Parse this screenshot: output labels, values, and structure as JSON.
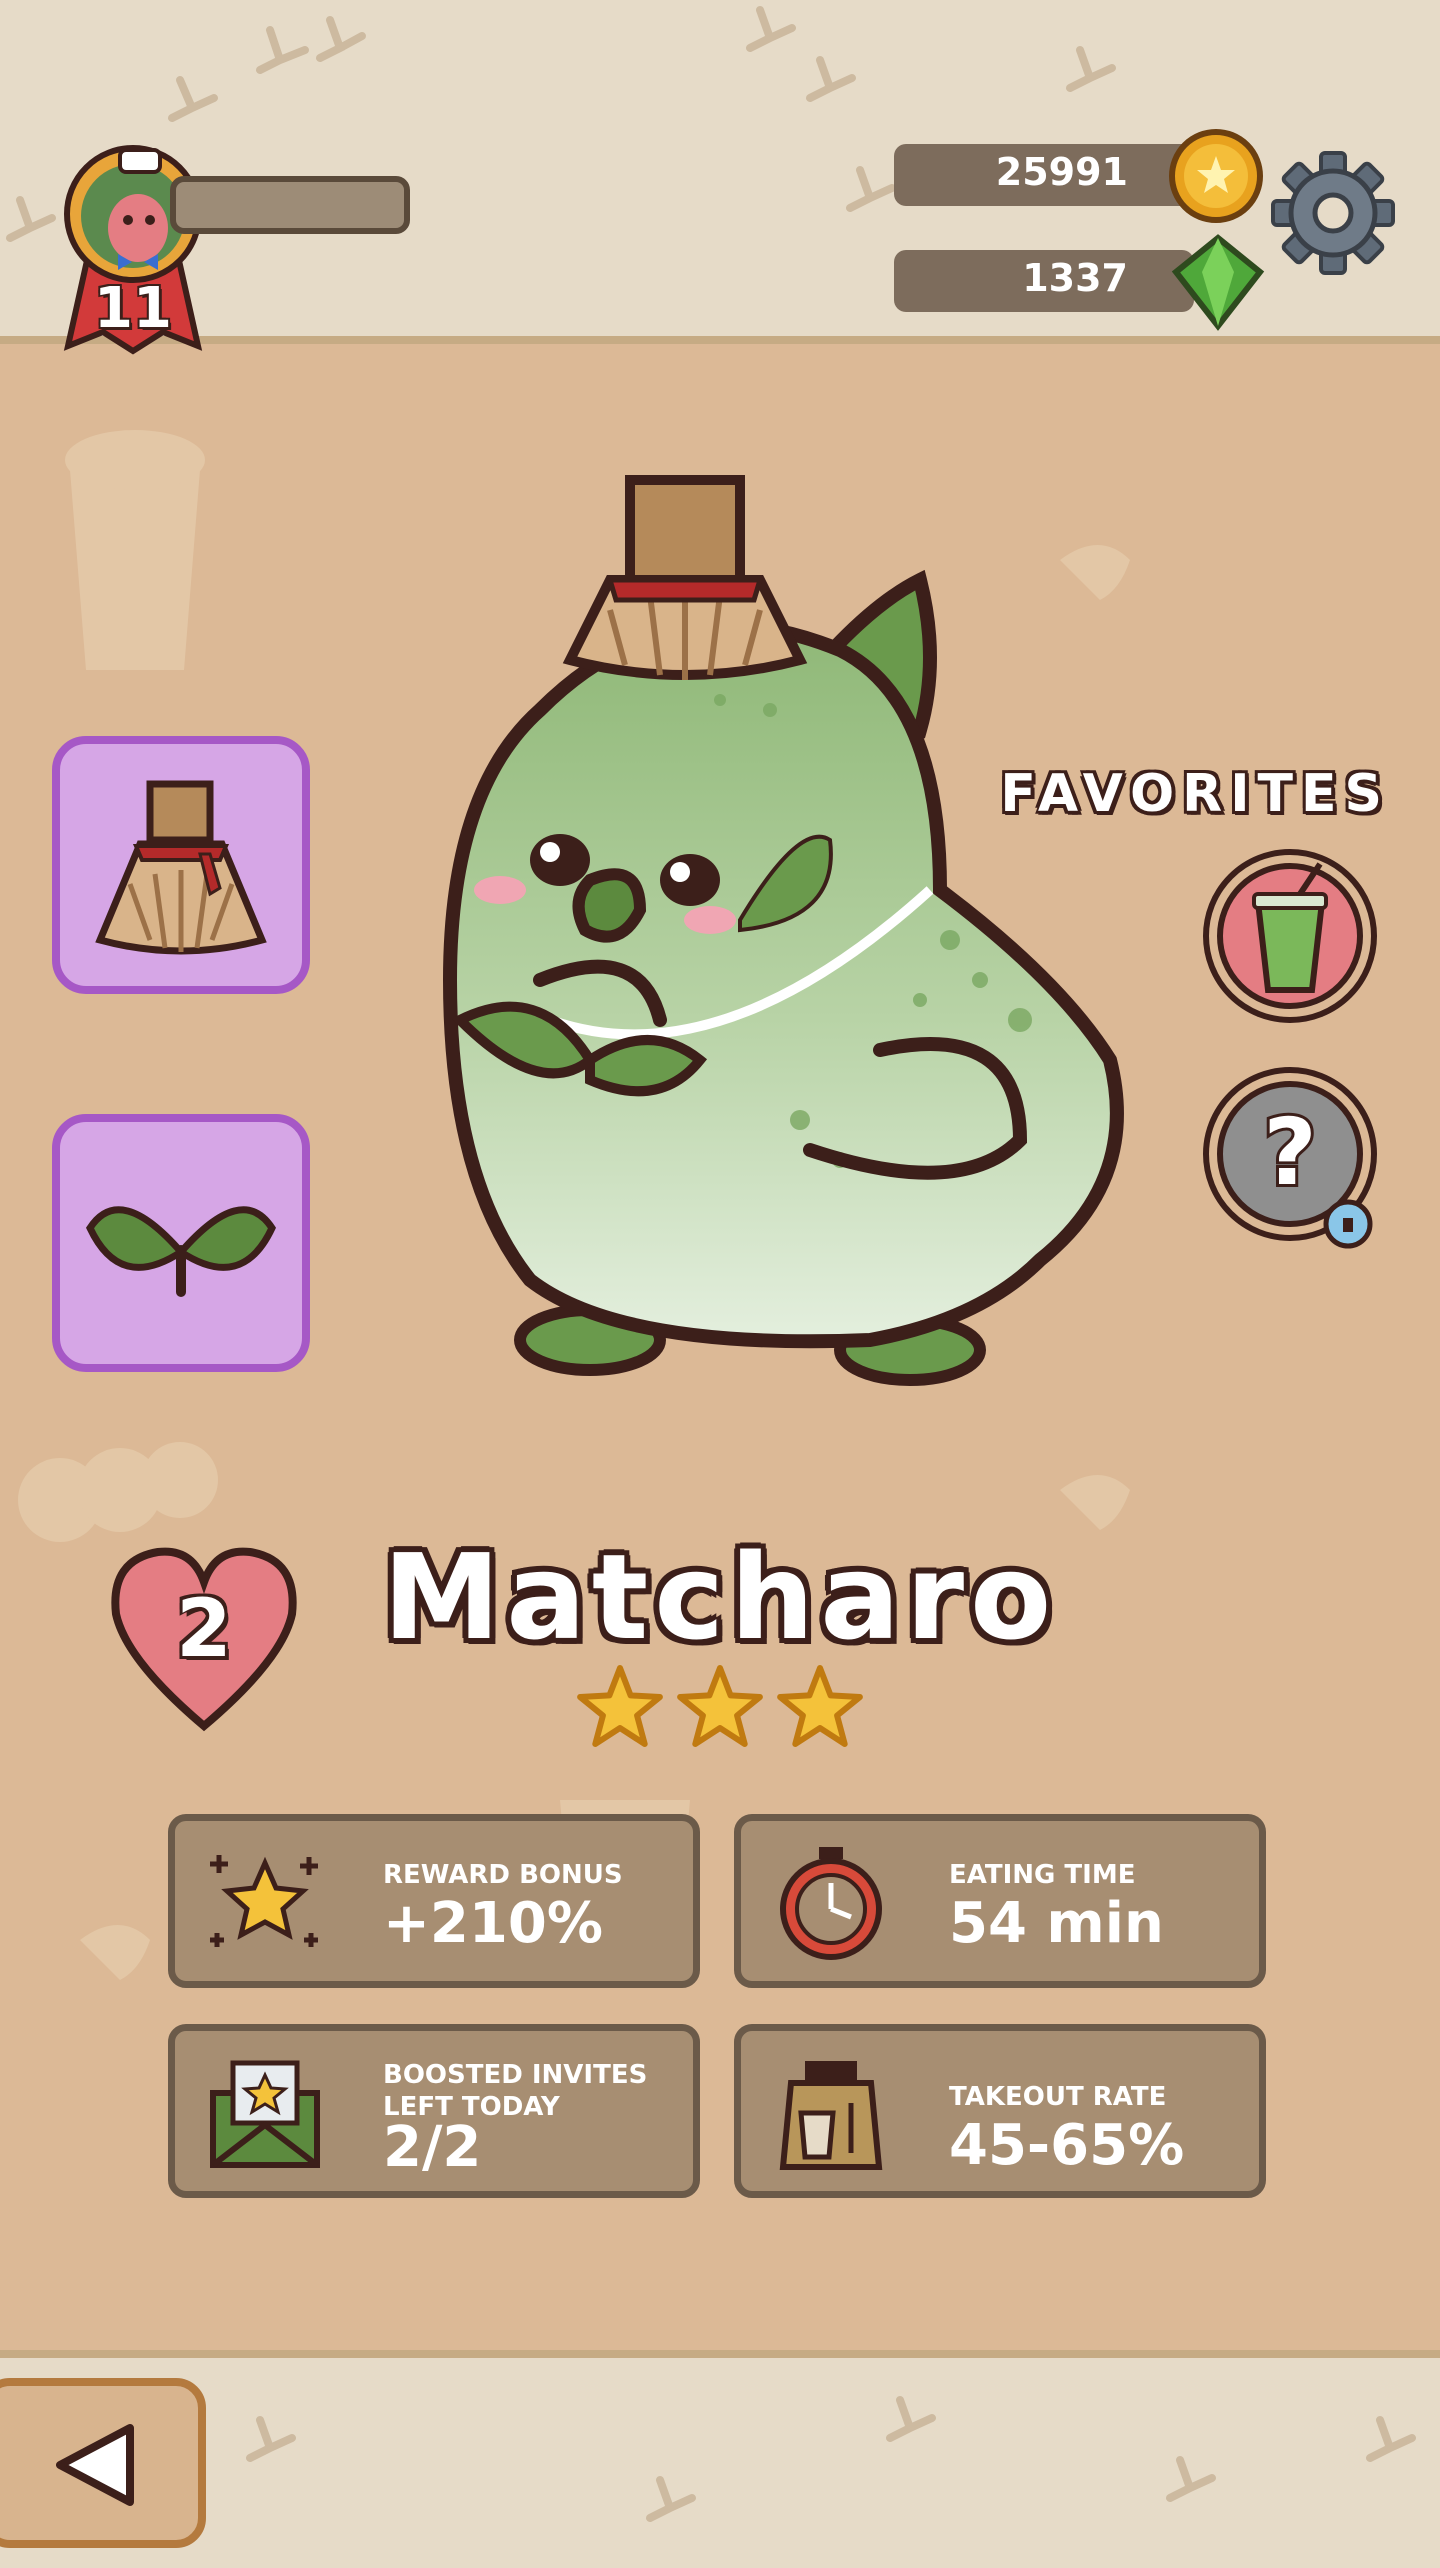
{
  "player": {
    "level": "11",
    "avatar_icon": "parrot-chef-avatar-icon"
  },
  "currencies": {
    "coins": "25991",
    "gems": "1337",
    "coin_icon": "gold-coin-icon",
    "gem_icon": "green-gem-icon"
  },
  "settings_icon": "gear-icon",
  "items": [
    {
      "icon": "matcha-whisk-hat-icon"
    },
    {
      "icon": "leaf-sprout-icon"
    }
  ],
  "favorites": {
    "label": "FAVORITES",
    "slots": [
      {
        "icon": "matcha-drink-icon"
      },
      {
        "icon": "locked-question-icon",
        "text": "?"
      }
    ]
  },
  "character": {
    "name": "Matcharo",
    "hearts": "2",
    "stars": 3,
    "star_max": 3
  },
  "stats": [
    {
      "label": "REWARD BONUS",
      "value": "+210%",
      "icon": "star-sparkle-icon"
    },
    {
      "label": "EATING TIME",
      "value": "54 min",
      "icon": "stopwatch-icon"
    },
    {
      "label_line1": "BOOSTED INVITES",
      "label_line2": "LEFT TODAY",
      "value": "2/2",
      "icon": "envelope-star-icon"
    },
    {
      "label": "TAKEOUT RATE",
      "value": "45-65%",
      "icon": "takeout-bag-icon"
    }
  ],
  "nav": {
    "back_icon": "back-arrow-icon"
  },
  "colors": {
    "background": "#dcb996",
    "band": "#e6dbc8",
    "slot_fill": "#d6a6e6",
    "slot_border": "#a658c6",
    "card_fill": "#a78e72",
    "outline": "#3c1f1a",
    "heart": "#e47d83",
    "character_green": "#8fb877"
  }
}
